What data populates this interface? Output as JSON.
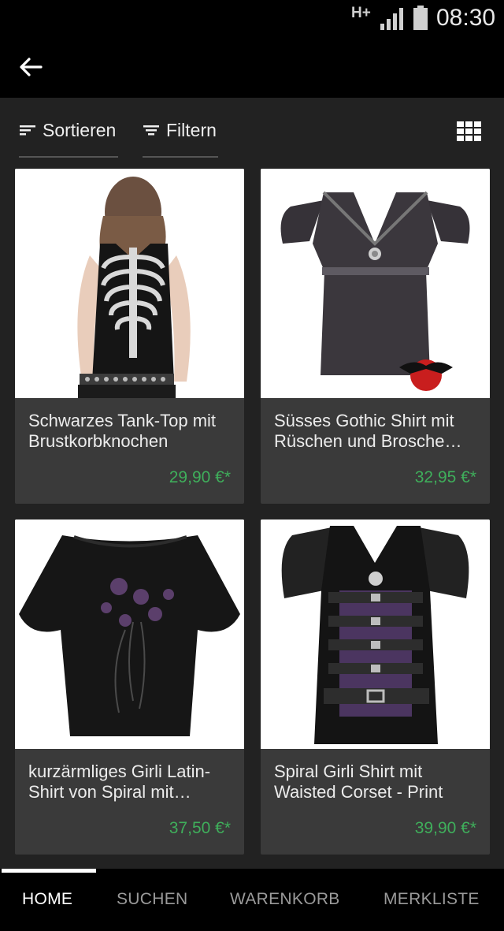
{
  "status": {
    "network": "H+",
    "time": "08:30"
  },
  "appbar": {
    "back_icon": "arrow-left-icon"
  },
  "toolbar": {
    "sort_label": "Sortieren",
    "filter_label": "Filtern",
    "view_toggle_icon": "grid-view-icon"
  },
  "products": [
    {
      "title": "Schwarzes Tank-Top mit Brustkorbknochen",
      "price": "29,90 €*"
    },
    {
      "title": "Süsses Gothic Shirt mit Rüschen und Brosche…",
      "price": "32,95 €*"
    },
    {
      "title": "kurzärmliges Girli Latin-Shirt von Spiral mit…",
      "price": "37,50 €*"
    },
    {
      "title": "Spiral Girli Shirt mit Waisted Corset - Print",
      "price": "39,90 €*"
    }
  ],
  "nav": {
    "tabs": [
      {
        "label": "HOME",
        "active": true
      },
      {
        "label": "SUCHEN",
        "active": false
      },
      {
        "label": "WARENKORB",
        "active": false
      },
      {
        "label": "MERKLISTE",
        "active": false
      }
    ]
  },
  "colors": {
    "price": "#3fae5b",
    "card": "#3a3a3a",
    "background": "#222222",
    "bars": "#000000"
  }
}
